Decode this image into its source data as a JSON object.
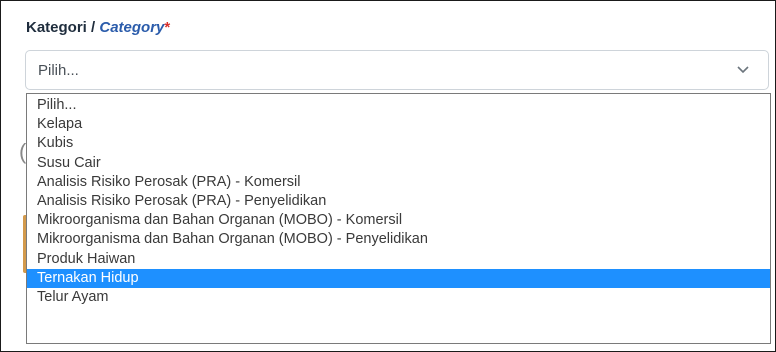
{
  "field": {
    "label_ms": "Kategori",
    "separator": " / ",
    "label_en": "Category",
    "required_mark": "*",
    "selected_value": "Pilih..."
  },
  "dropdown": {
    "options": [
      "Pilih...",
      "Kelapa",
      "Kubis",
      "Susu Cair",
      "Analisis Risiko Perosak (PRA) - Komersil",
      "Analisis Risiko Perosak (PRA) - Penyelidikan",
      "Mikroorganisma dan Bahan Organan (MOBO) - Komersil",
      "Mikroorganisma dan Bahan Organan (MOBO) - Penyelidikan",
      "Produk Haiwan",
      "Ternakan Hidup",
      "Telur Ayam"
    ],
    "highlighted": "Ternakan Hidup"
  },
  "colors": {
    "accent_label": "#2b5cab",
    "required": "#d9302b",
    "highlight": "#1e90ff"
  },
  "icons": {
    "select_arrow": "chevron-down-icon"
  }
}
